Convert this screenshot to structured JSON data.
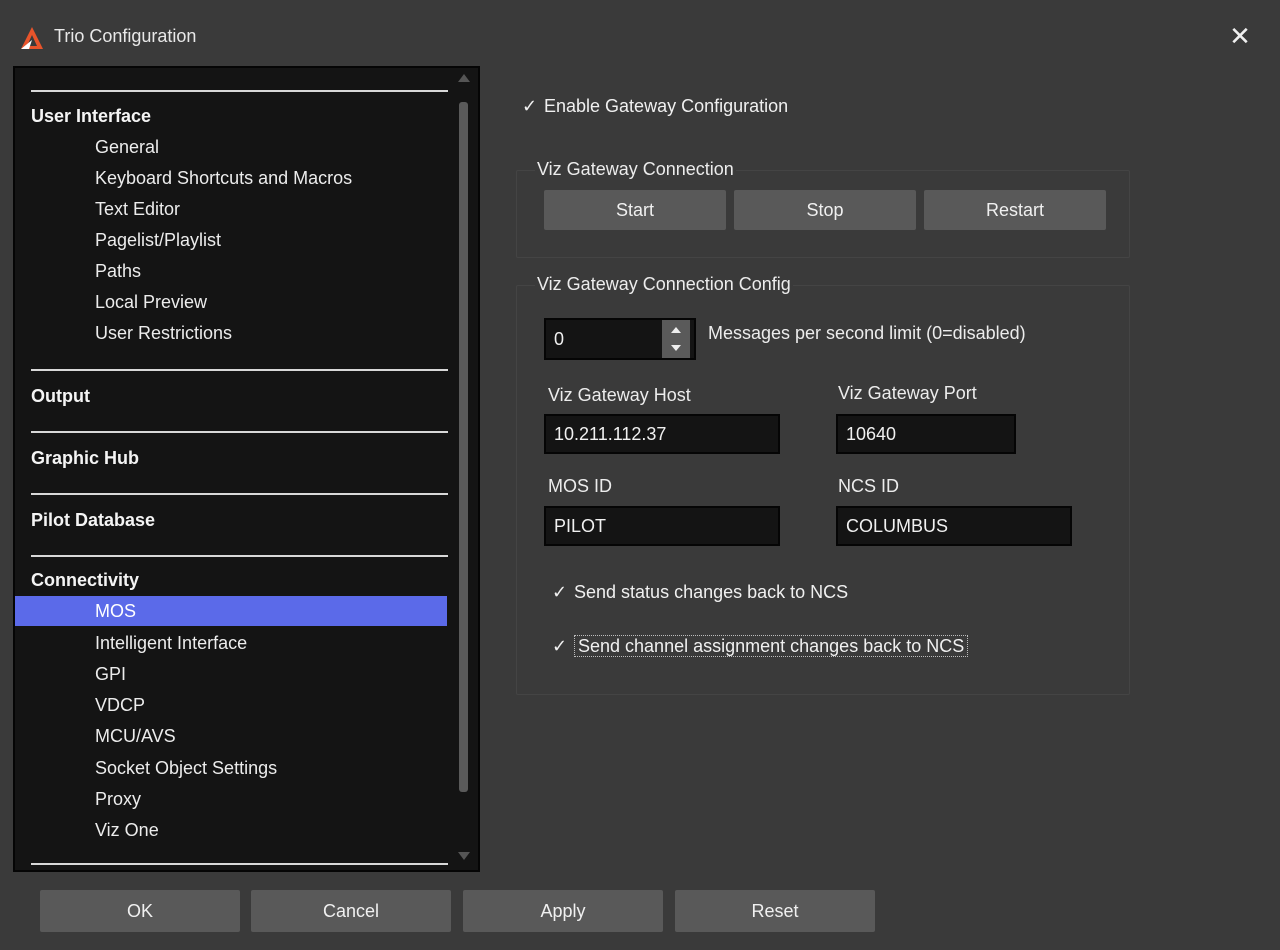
{
  "window": {
    "title": "Trio Configuration",
    "close_glyph": "✕"
  },
  "tree": {
    "sections": [
      {
        "header": "User Interface",
        "items": [
          "General",
          "Keyboard Shortcuts and Macros",
          "Text Editor",
          "Pagelist/Playlist",
          "Paths",
          "Local Preview",
          "User Restrictions"
        ]
      },
      {
        "header": "Output",
        "items": []
      },
      {
        "header": "Graphic Hub",
        "items": []
      },
      {
        "header": "Pilot Database",
        "items": []
      },
      {
        "header": "Connectivity",
        "items": [
          "MOS",
          "Intelligent Interface",
          "GPI",
          "VDCP",
          "MCU/AVS",
          "Socket Object Settings",
          "Proxy",
          "Viz One"
        ]
      }
    ],
    "selected_item": "MOS"
  },
  "gateway": {
    "enable_label": "Enable Gateway Configuration",
    "connection_group": "Viz Gateway Connection",
    "start_label": "Start",
    "stop_label": "Stop",
    "restart_label": "Restart",
    "config_group": "Viz Gateway Connection Config",
    "msg_limit_value": "0",
    "msg_limit_label": "Messages per second limit (0=disabled)",
    "host_label": "Viz Gateway Host",
    "host_value": "10.211.112.37",
    "port_label": "Viz Gateway Port",
    "port_value": "10640",
    "mos_id_label": "MOS ID",
    "mos_id_value": "PILOT",
    "ncs_id_label": "NCS ID",
    "ncs_id_value": "COLUMBUS",
    "send_status_label": "Send status changes back to NCS",
    "send_channel_label": "Send channel assignment changes back to NCS",
    "check_glyph": "✓"
  },
  "footer": {
    "ok_label": "OK",
    "cancel_label": "Cancel",
    "apply_label": "Apply",
    "reset_label": "Reset"
  },
  "colors": {
    "background": "#3a3a3a",
    "panel": "#141414",
    "selection": "#5b6ae9",
    "button": "#595959",
    "logo_orange": "#e8542b"
  }
}
